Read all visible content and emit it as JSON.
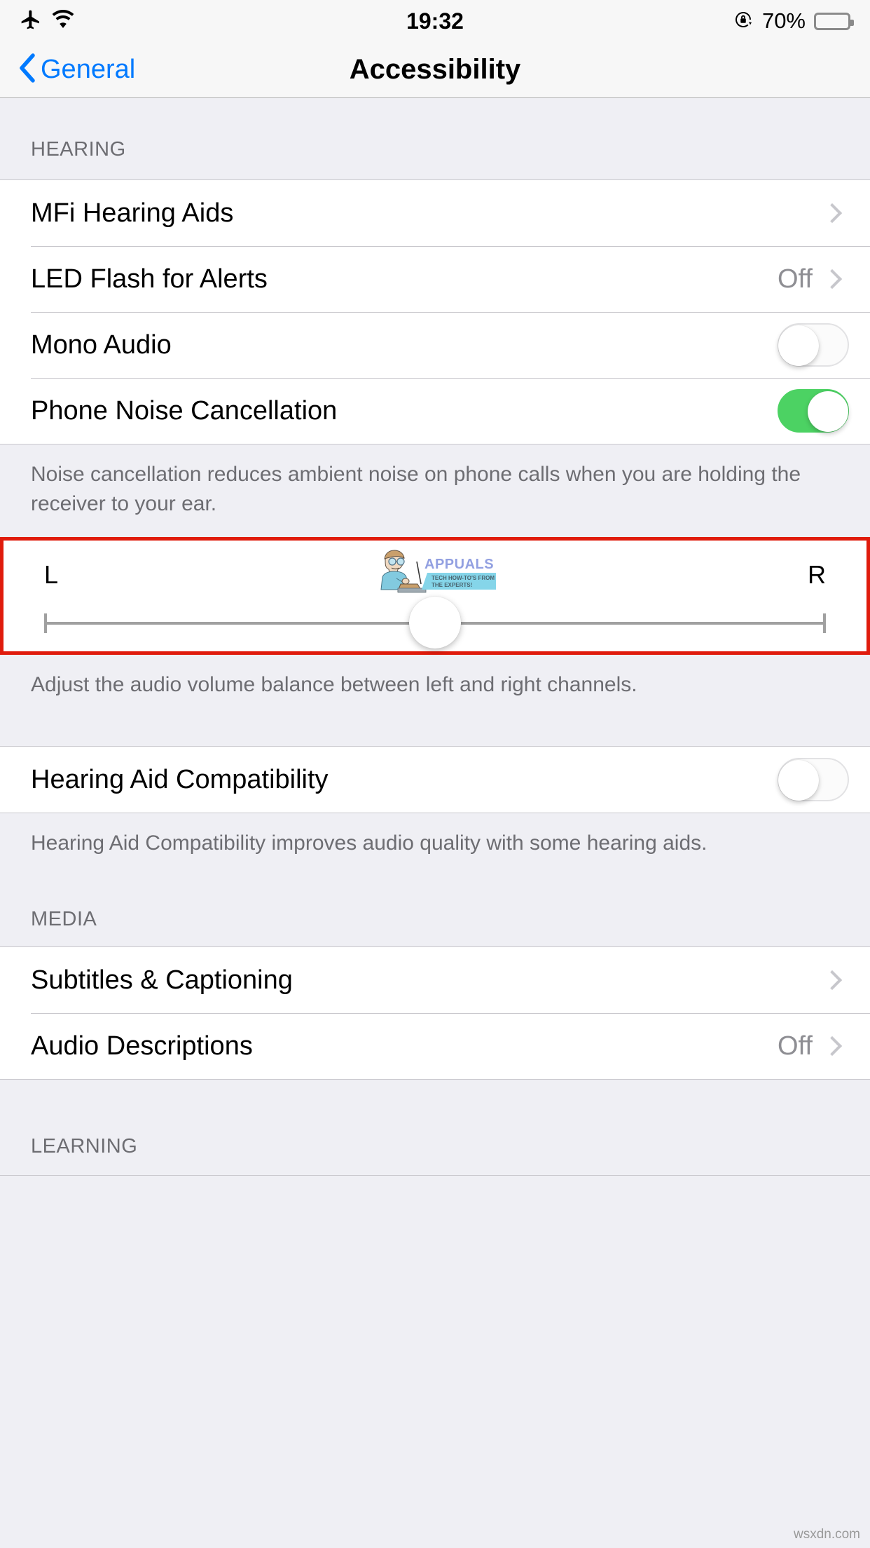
{
  "status_bar": {
    "airplane_icon": "airplane-icon",
    "wifi_icon": "wifi-icon",
    "time": "19:32",
    "rotation_lock_icon": "rotation-lock-icon",
    "battery_percent": "70%",
    "battery_level": 70
  },
  "nav": {
    "back_label": "General",
    "title": "Accessibility",
    "accent_color": "#007AFF"
  },
  "sections": {
    "hearing_header": "HEARING",
    "media_header": "MEDIA",
    "learning_header": "LEARNING"
  },
  "rows": {
    "mfi_hearing_aids": {
      "label": "MFi Hearing Aids",
      "value": "",
      "type": "disclosure"
    },
    "led_flash": {
      "label": "LED Flash for Alerts",
      "value": "Off",
      "type": "disclosure"
    },
    "mono_audio": {
      "label": "Mono Audio",
      "state": "off",
      "type": "toggle"
    },
    "phone_noise_cancellation": {
      "label": "Phone Noise Cancellation",
      "state": "on",
      "type": "toggle"
    },
    "hearing_aid_compatibility": {
      "label": "Hearing Aid Compatibility",
      "state": "off",
      "type": "toggle"
    },
    "subtitles_captioning": {
      "label": "Subtitles & Captioning",
      "value": "",
      "type": "disclosure"
    },
    "audio_descriptions": {
      "label": "Audio Descriptions",
      "value": "Off",
      "type": "disclosure"
    }
  },
  "footers": {
    "noise_cancellation": "Noise cancellation reduces ambient noise on phone calls when you are holding the receiver to your ear.",
    "balance": "Adjust the audio volume balance between left and right channels.",
    "hearing_aid_compatibility": "Hearing Aid Compatibility improves audio quality with some hearing aids."
  },
  "balance_slider": {
    "left_label": "L",
    "right_label": "R",
    "value": 50,
    "highlight_color": "#E01B0C"
  },
  "watermarks": {
    "logo_title": "APPUALS",
    "logo_tagline_line1": "TECH HOW-TO'S FROM",
    "logo_tagline_line2": "THE EXPERTS!",
    "corner": "wsxdn.com"
  },
  "colors": {
    "toggle_on": "#4CD263",
    "group_bg": "#EFEFF4",
    "separator": "#C8C7CC",
    "secondary_text": "#8E8E93"
  }
}
